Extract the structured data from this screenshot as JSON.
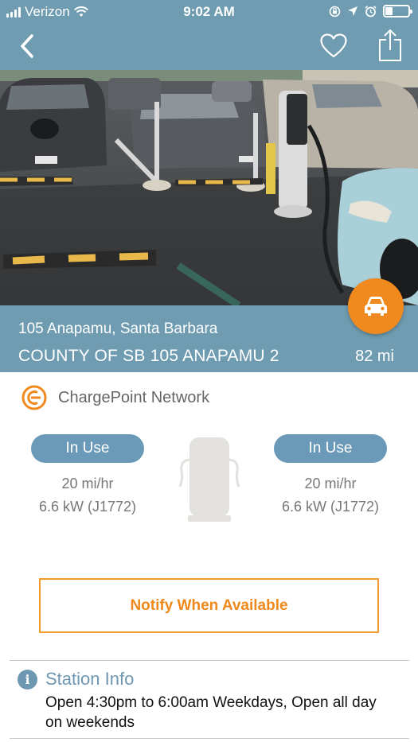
{
  "status_bar": {
    "carrier": "Verizon",
    "time": "9:02 AM"
  },
  "nav": {
    "back_icon": "chevron-left-icon",
    "favorite_icon": "heart-outline-icon",
    "share_icon": "share-icon"
  },
  "photo": {
    "page_count": 3,
    "active_page": 2
  },
  "station": {
    "address": "105 Anapamu, Santa Barbara",
    "name": "COUNTY OF SB 105 ANAPAMU 2",
    "distance": "82 mi"
  },
  "fab": {
    "icon": "car-icon"
  },
  "network": {
    "icon": "chargepoint-logo-icon",
    "name": "ChargePoint Network"
  },
  "ports": [
    {
      "status": "In Use",
      "speed": "20 mi/hr",
      "power": "6.6 kW (J1772)"
    },
    {
      "status": "In Use",
      "speed": "20 mi/hr",
      "power": "6.6 kW (J1772)"
    }
  ],
  "actions": {
    "notify_label": "Notify When Available"
  },
  "station_info": {
    "title": "Station Info",
    "hours": "Open 4:30pm to 6:00am Weekdays, Open all day on weekends"
  },
  "colors": {
    "header": "#6f9cb1",
    "accent_orange": "#f08a1e",
    "badge_blue": "#6b9ab8"
  }
}
